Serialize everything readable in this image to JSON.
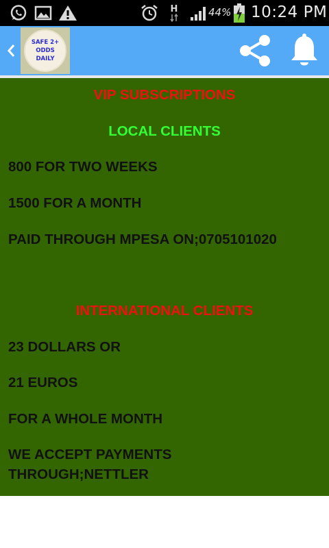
{
  "status_bar": {
    "icons": [
      "whatsapp-icon",
      "gallery-icon",
      "warning-icon",
      "alarm-icon",
      "network-h-icon",
      "signal-icon",
      "battery-charging-icon"
    ],
    "network_type": "H",
    "battery_percent": "44%",
    "time": "10:24 PM"
  },
  "app_bar": {
    "logo_lines": [
      "SAFE 2+",
      "ODDS",
      "DAILY"
    ],
    "background_color": "#55aaf8",
    "icons": [
      "back-arrow-icon",
      "share-icon",
      "bell-icon"
    ]
  },
  "content": {
    "background_color": "#336600",
    "vip_heading": "VIP SUBSCRIPTIONS",
    "local_heading": "LOCAL CLIENTS",
    "local_lines": [
      "800 FOR TWO WEEKS",
      "1500 FOR A MONTH",
      "PAID THROUGH MPESA ON;0705101020"
    ],
    "international_heading": "INTERNATIONAL CLIENTS",
    "international_lines": [
      "23 DOLLARS  OR",
      "21 EUROS",
      "FOR A WHOLE MONTH",
      "WE ACCEPT PAYMENTS",
      "THROUGH;NETTLER"
    ],
    "heading_colors": {
      "red": "#ee1111",
      "lime": "#33ff33"
    }
  }
}
